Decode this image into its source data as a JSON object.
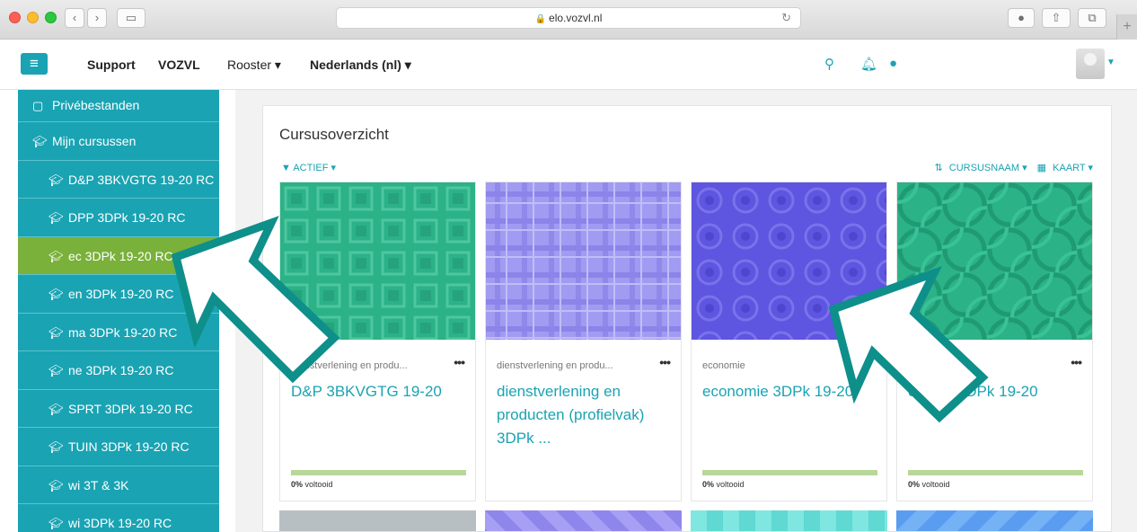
{
  "browser": {
    "url": "elo.vozvl.nl"
  },
  "navbar": {
    "links": [
      {
        "label": "Support"
      },
      {
        "label": "VOZVL"
      },
      {
        "label": "Rooster ▾"
      },
      {
        "label": "Nederlands (nl) ▾"
      }
    ]
  },
  "sidebar": {
    "items": [
      {
        "label": "Privébestanden",
        "icon": "file-icon"
      },
      {
        "label": "Mijn cursussen",
        "icon": "graduation-cap-icon"
      },
      {
        "label": "D&P 3BKVGTG 19-20 RC",
        "icon": "graduation-cap-icon"
      },
      {
        "label": "DPP 3DPk 19-20 RC",
        "icon": "graduation-cap-icon"
      },
      {
        "label": "ec 3DPk 19-20 RC",
        "icon": "graduation-cap-icon",
        "active": true
      },
      {
        "label": "en 3DPk 19-20 RC",
        "icon": "graduation-cap-icon"
      },
      {
        "label": "ma 3DPk 19-20 RC",
        "icon": "graduation-cap-icon"
      },
      {
        "label": "ne 3DPk 19-20 RC",
        "icon": "graduation-cap-icon"
      },
      {
        "label": "SPRT 3DPk 19-20 RC",
        "icon": "graduation-cap-icon"
      },
      {
        "label": "TUIN 3DPk 19-20 RC",
        "icon": "graduation-cap-icon"
      },
      {
        "label": "wi 3T & 3K",
        "icon": "graduation-cap-icon"
      },
      {
        "label": "wi 3DPk 19-20 RC",
        "icon": "graduation-cap-icon"
      }
    ],
    "active_color": "#79b13a",
    "bg_color": "#1aa3b3"
  },
  "overview": {
    "heading": "Cursusoverzicht",
    "filter_label": "ACTIEF",
    "sort_label": "CURSUSNAAM",
    "view_label": "KAART"
  },
  "courses": [
    {
      "category": "dienstverlening en produ...",
      "title": "D&P 3BKVGTG 19-20",
      "progress_pct": "0%",
      "progress_suffix": " voltooid",
      "color": "#2bb287"
    },
    {
      "category": "dienstverlening en produ...",
      "title": "dienstverlening en producten (profielvak) 3DPk ...",
      "progress_pct": "",
      "progress_suffix": "",
      "color": "#9b93ef"
    },
    {
      "category": "economie",
      "title": "economie 3DPk 19-20",
      "progress_pct": "0%",
      "progress_suffix": " voltooid",
      "color": "#5e55e0"
    },
    {
      "category": "",
      "title": "engels 3DPk 19-20",
      "progress_pct": "0%",
      "progress_suffix": " voltooid",
      "color": "#2bb287"
    }
  ],
  "accent_color": "#1aa3b3"
}
